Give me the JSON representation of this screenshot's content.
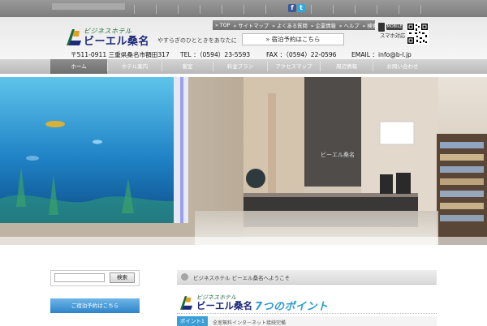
{
  "topbar": {
    "faint_text": "",
    "facebook_icon": "facebook-icon",
    "twitter_icon": "twitter-icon",
    "facebook_glyph": "f",
    "twitter_glyph": "t"
  },
  "logo": {
    "small_text": "ビジネスホテル",
    "main_text": "ビーエル桑名",
    "tagline": "やすらぎのひとときをあなたに"
  },
  "toplinks": [
    "» TOP",
    "» サイトマップ",
    "» よくある質問",
    "» 企業情報",
    "» ヘルプ",
    "» 検索"
  ],
  "reserve_button": "» 宿泊予約はこちら",
  "mobile": {
    "badge": "MOBILE",
    "label": "スマホ対応"
  },
  "contact": {
    "address": "〒511-0911 三重県桑名市額田317",
    "tel": "TEL ：（0594）23-5593",
    "fax": "FAX ：（0594）22-0596",
    "email": "EMAIL ：info@b-l.jp"
  },
  "nav": [
    {
      "label": "ホーム",
      "active": true
    },
    {
      "label": "ホテル案内",
      "active": false
    },
    {
      "label": "客室",
      "active": false
    },
    {
      "label": "料金プラン",
      "active": false
    },
    {
      "label": "アクセスマップ",
      "active": false
    },
    {
      "label": "周辺情報",
      "active": false
    },
    {
      "label": "お問い合わせ",
      "active": false
    }
  ],
  "hero": {
    "sign_text": "ビーエル桑名"
  },
  "sidebar": {
    "search_placeholder": "",
    "search_button": "検索",
    "blue_button": "ご宿泊予約はこちら"
  },
  "main": {
    "section_title": "ビジネスホテル ビーエル桑名へようこそ",
    "points_small": "ビジネスホテル",
    "points_logo": "ビーエル桑名",
    "points_headline": "7つのポイント",
    "point1_badge": "ポイント1",
    "point1_text": "全室無料インターネット接続完備"
  },
  "colors": {
    "accent_blue": "#2e9bd1",
    "brand_navy": "#1d2a7a",
    "brand_green": "#1a6a3a",
    "button_blue": "#2c84c9"
  }
}
